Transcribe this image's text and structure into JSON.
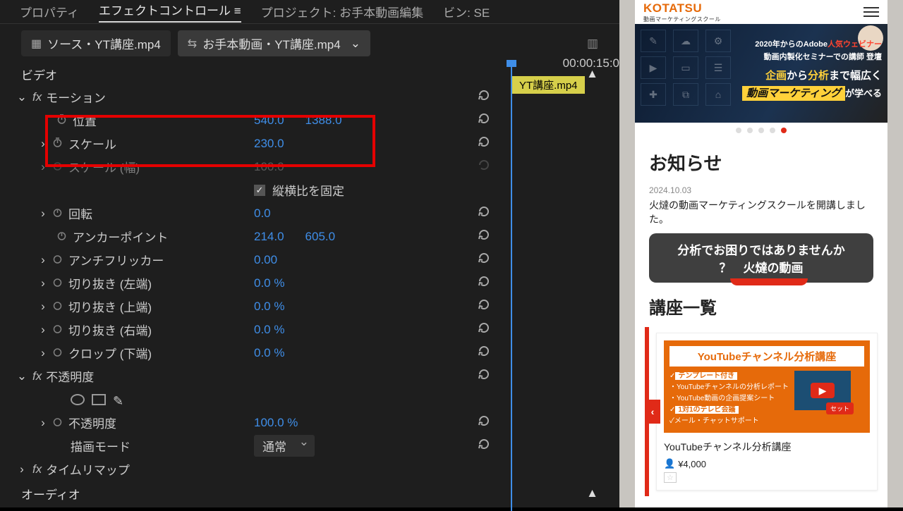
{
  "tabs": {
    "properties": "プロパティ",
    "effect_controls": "エフェクトコントロール",
    "menu_glyph": "≡",
    "project": "プロジェクト: お手本動画編集",
    "bin": "ビン: SE"
  },
  "sources": {
    "source": "ソース・YT講座.mp4",
    "master": "お手本動画・YT講座.mp4"
  },
  "section_video": "ビデオ",
  "timeline": {
    "time": "00:00:15:0",
    "clip": "YT講座.mp4"
  },
  "motion": {
    "label": "モーション",
    "position": {
      "label": "位置",
      "x": "540.0",
      "y": "1388.0"
    },
    "scale": {
      "label": "スケール",
      "v": "230.0"
    },
    "scale_w": {
      "label": "スケール (幅)",
      "v": "100.0"
    },
    "uniform": {
      "label": "縦横比を固定"
    },
    "rotation": {
      "label": "回転",
      "v": "0.0"
    },
    "anchor": {
      "label": "アンカーポイント",
      "x": "214.0",
      "y": "605.0"
    },
    "antiflicker": {
      "label": "アンチフリッカー",
      "v": "0.00"
    },
    "crop_l": {
      "label": "切り抜き (左端)",
      "v": "0.0 %"
    },
    "crop_t": {
      "label": "切り抜き (上端)",
      "v": "0.0 %"
    },
    "crop_r": {
      "label": "切り抜き (右端)",
      "v": "0.0 %"
    },
    "crop_b": {
      "label": "クロップ (下端)",
      "v": "0.0 %"
    }
  },
  "opacity": {
    "label": "不透明度",
    "value_label": "不透明度",
    "value": "100.0 %",
    "blend_label": "描画モード",
    "blend_value": "通常"
  },
  "timeremap": "タイムリマップ",
  "section_audio": "オーディオ",
  "phone": {
    "brand": "KOTATSU",
    "brand_sub": "動画マーケティングスクール",
    "hero": {
      "l1a": "2020年からのAdobe",
      "l1b": "人気ウェビナー",
      "l2": "動画内製化セミナーでの講師 登壇",
      "l3a": "企画",
      "l3b": "から",
      "l3c": "分析",
      "l3d": "まで幅広く",
      "l4a": "動画マーケティング",
      "l4b": "が学べる"
    },
    "news_h": "お知らせ",
    "news_date": "2024.10.03",
    "news_body": "火燵の動画マーケティングスクールを開講しました。",
    "callout1": "分析でお困りではありませんか",
    "callout2": "？　火燵の動画",
    "courses_h": "講座一覧",
    "card": {
      "title_banner": "YouTubeチャンネル分析講座",
      "feat_hd1": "テンプレート付き",
      "feat1": "・YouTubeチャンネルの分析レポート",
      "feat2": "・YouTube動画の企画提案シート",
      "feat_hd2": "1対1のテレビ会議",
      "feat3": "メール・チャットサポート",
      "badge": "セット",
      "title": "YouTubeチャンネル分析講座",
      "price": "¥4,000",
      "star": "☆"
    }
  }
}
